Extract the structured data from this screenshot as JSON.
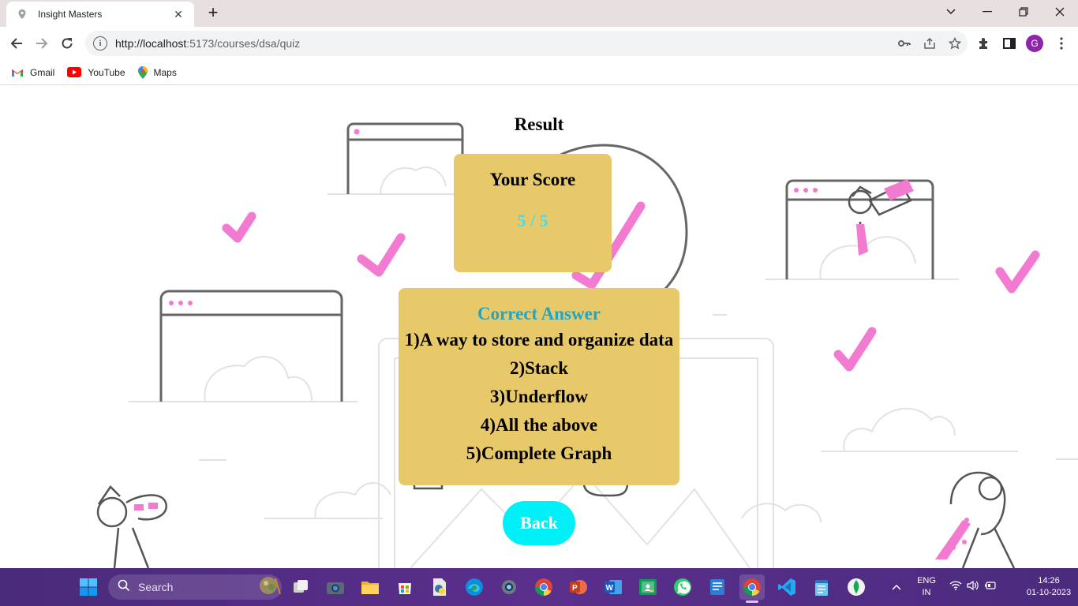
{
  "browser": {
    "tab_title": "Insight Masters",
    "tab_close": "✕",
    "new_tab": "+",
    "url_host": "http://localhost",
    "url_path": ":5173/courses/dsa/quiz",
    "profile_initial": "G",
    "bookmarks": [
      {
        "label": "Gmail",
        "icon": "gmail-icon"
      },
      {
        "label": "YouTube",
        "icon": "youtube-icon"
      },
      {
        "label": "Maps",
        "icon": "maps-icon"
      }
    ]
  },
  "page": {
    "result_title": "Result",
    "score_label": "Your Score",
    "score_value": "5 / 5",
    "answers_title": "Correct Answer",
    "answers": [
      "1)A way to store and organize data",
      "2)Stack",
      "3)Underflow",
      "4)All the above",
      "5)Complete Graph"
    ],
    "back_label": "Back"
  },
  "taskbar": {
    "search_label": "Search",
    "lang_line1": "ENG",
    "lang_line2": "IN",
    "time": "14:26",
    "date": "01-10-2023"
  },
  "colors": {
    "card_bg": "#e8c96a",
    "score_value": "#4fd8e6",
    "answers_title": "#1ea6c8",
    "back_button": "#00f0f8",
    "checkmark": "#f27ad0"
  }
}
